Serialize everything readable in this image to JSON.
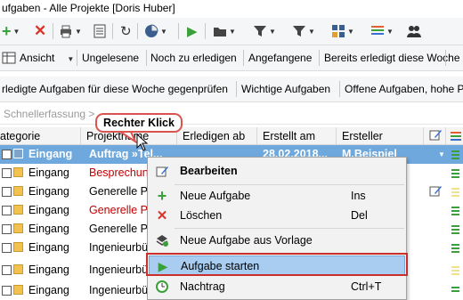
{
  "window": {
    "title": "ufgaben - Alle Projekte [Doris Huber]"
  },
  "icon_toolbar": {
    "icons": [
      "add-icon",
      "delete-icon",
      "print-icon",
      "document-icon",
      "refresh-icon",
      "pie-chart-icon",
      "play-icon",
      "folder-icon",
      "filter-icon",
      "filter-icon",
      "view-icon",
      "columns-icon",
      "users-icon"
    ]
  },
  "toolbar1": {
    "view_label": "Ansicht",
    "buttons": [
      "Ungelesene",
      "Noch zu erledigen",
      "Angefangene",
      "Bereits erledigt diese Woche"
    ]
  },
  "toolbar2": {
    "buttons": [
      "rledigte Aufgaben für diese Woche gegenprüfen",
      "Wichtige Aufgaben",
      "Offene Aufgaben, hohe P"
    ]
  },
  "quick_entry": {
    "placeholder": "Schnellerfassung >"
  },
  "table": {
    "headers": [
      "ategorie",
      "Projektname",
      "Erledigen ab",
      "Erstellt am",
      "Ersteller"
    ],
    "rows": [
      {
        "category": "Eingang",
        "project": "Auftrag »Tel...",
        "erledigen": "",
        "erstellt": "28.02.2018...",
        "ersteller": "M.Beispiel",
        "selected": true
      },
      {
        "category": "Eingang",
        "project": "Besprechun",
        "red": true
      },
      {
        "category": "Eingang",
        "project": "Generelle Pr",
        "red": false
      },
      {
        "category": "Eingang",
        "project": "Generelle Pr",
        "red": true
      },
      {
        "category": "Eingang",
        "project": "Generelle Pr",
        "red": false
      },
      {
        "category": "Eingang",
        "project": "Ingenieurbü",
        "red": false
      },
      {
        "category": "Eingang",
        "project": "Ingenieurbü",
        "red": false
      },
      {
        "category": "Eingang",
        "project": "Ingenieurbü",
        "red": false
      }
    ]
  },
  "callout": {
    "text": "Rechter Klick"
  },
  "context_menu": {
    "edit": "Bearbeiten",
    "new_task": "Neue Aufgabe",
    "new_task_shortcut": "Ins",
    "delete": "Löschen",
    "delete_shortcut": "Del",
    "new_from_template": "Neue Aufgabe aus Vorlage",
    "start_task": "Aufgabe starten",
    "addendum": "Nachtrag",
    "addendum_shortcut": "Ctrl+T"
  },
  "colors": {
    "selection": "#6fa8dc",
    "highlight": "#c9302c",
    "menu_hover": "#a8cdf0",
    "category": "#f2c14e"
  }
}
